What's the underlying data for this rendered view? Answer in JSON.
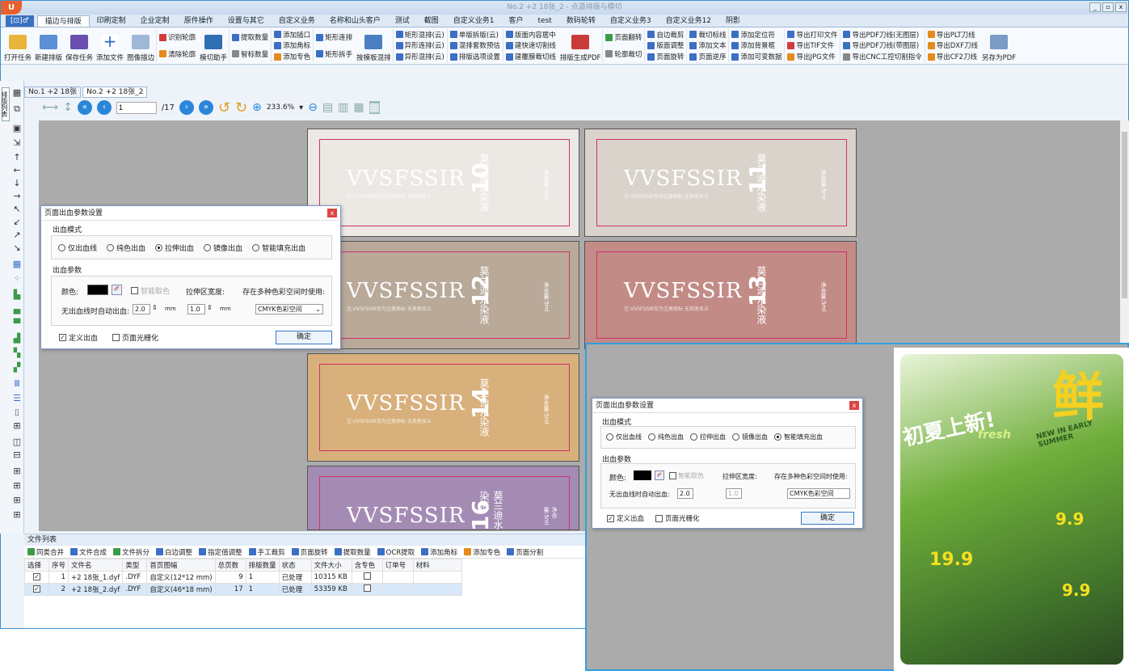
{
  "window": {
    "title": "No.2 +2 18张_2 - 点源排版与模切",
    "app_badge": "U"
  },
  "menu_tab": "[⊡]♂",
  "tabs": [
    "描边与排版",
    "印刷定制",
    "企业定制",
    "原件操作",
    "设置与其它",
    "自定义业务",
    "名称和山头客户",
    "测试",
    "截图",
    "自定义业务1",
    "客户",
    "test",
    "数码轮转",
    "自定义业务3",
    "自定义业务12",
    "阴影"
  ],
  "ribbon": {
    "big": [
      "打开任务",
      "新建排版",
      "保存任务",
      "添加文件",
      "图像描边"
    ],
    "col1": [
      "识别轮廓",
      "清除轮廓"
    ],
    "big2": "模切助手",
    "col2": [
      "提取数量",
      "智标数量"
    ],
    "col3": [
      "添加插口",
      "添加角标",
      "添加专色"
    ],
    "col4": [
      "矩形连排",
      "矩形拆手"
    ],
    "big3": "按模板混排",
    "col5": [
      "矩形混排(云)",
      "异形连排(云)",
      "异形混排(云)"
    ],
    "col6": [
      "单版拆版(云)",
      "混排套数预估",
      "排版选项设置"
    ],
    "col7": [
      "版面内容居中",
      "建快速切割线",
      "建覆膜裁切线"
    ],
    "big4": "排版生成PDF",
    "col8": [
      "页面翻转",
      "轮廓裁切"
    ],
    "col9": [
      "自边裁剪",
      "版面调整",
      "页面旋转"
    ],
    "col10": [
      "裁切标线",
      "添加文本",
      "页面逆序"
    ],
    "col11": [
      "添加定位符",
      "添加背景框",
      "添加可变数据"
    ],
    "col12": [
      "导出打印文件",
      "导出TIF文件",
      "导出JPG文件"
    ],
    "col13": [
      "导出PDF刀线(无图层)",
      "导出PDF刀线(带图层)",
      "导出CNC工控切割指令"
    ],
    "col14": [
      "导出PLT刀线",
      "导出DXF刀线",
      "导出CF2刀线"
    ],
    "big5": "另存为PDF"
  },
  "doc_tabs": [
    "No.1 +2 18张",
    "No.2 +2 18张_2"
  ],
  "nav": {
    "page": "1",
    "total": "/17",
    "zoom": "233.6%"
  },
  "side_tab": "排版列表",
  "cards": [
    {
      "num": "10",
      "bg": "#ece9e4",
      "brand": "VVSFSSIR",
      "cn": "莫兰迪水染液",
      "sub": "注:VVSFSSIR仅为注册商标 无其他含义",
      "vol": "净含量:5ml"
    },
    {
      "num": "11",
      "bg": "#d9d3cc",
      "brand": "VVSFSSIR",
      "cn": "莫兰迪水染液",
      "sub": "注:VVSFSSIR仅为注册商标 无其他含义",
      "vol": "净含量:5ml"
    },
    {
      "num": "12",
      "bg": "#b9a999",
      "brand": "VVSFSSIR",
      "cn": "莫兰迪水染液",
      "sub": "注:VVSFSSIR仅为注册商标 无其他含义",
      "vol": "净含量:5ml"
    },
    {
      "num": "13",
      "bg": "#c28b86",
      "brand": "VVSFSSIR",
      "cn": "莫兰迪水染液",
      "sub": "注:VVSFSSIR仅为注册商标 无其他含义",
      "vol": "净含量:5ml"
    },
    {
      "num": "14",
      "bg": "#d8b07c",
      "brand": "VVSFSSIR",
      "cn": "莫兰迪水染液",
      "sub": "注:VVSFSSIR仅为注册商标 无其他含义",
      "vol": "净含量:5ml"
    },
    {
      "num": "16",
      "bg": "#a48bb4",
      "brand": "VVSFSSIR",
      "cn": "莫兰迪水染液",
      "sub": "",
      "vol": "净含量:5ml"
    }
  ],
  "dialog1": {
    "title": "页面出血参数设置",
    "mode_label": "出血模式",
    "modes": [
      "仅出血线",
      "纯色出血",
      "拉伸出血",
      "镜像出血",
      "智能填充出血"
    ],
    "selected": 2,
    "param_label": "出血参数",
    "color_label": "颜色:",
    "smart_color": "智能取色",
    "stretch_label": "拉伸区宽度:",
    "colorspace_label": "存在多种色彩空间时使用:",
    "auto_label": "无出血线时自动出血:",
    "auto_val": "2.0",
    "stretch_val": "1.0",
    "unit": "mm",
    "colorspace": "CMYK色彩空间",
    "custom": "定义出血",
    "raster": "页面光栅化",
    "ok": "确定"
  },
  "dialog2": {
    "selected": 4
  },
  "filelist": {
    "title": "文件列表",
    "tools": [
      "同类合并",
      "文件合成",
      "文件拆分",
      "白边调整",
      "指定值调整",
      "手工裁剪",
      "页面旋转",
      "提取数量",
      "OCR提取",
      "添加角标",
      "添加专色",
      "页面分割"
    ],
    "headers": [
      "选择",
      "序号",
      "文件名",
      "类型",
      "首页图幅",
      "总页数",
      "排版数量",
      "状态",
      "文件大小",
      "含专色",
      "订单号",
      "材料"
    ],
    "rows": [
      {
        "idx": "1",
        "name": "+2 18张_1.dyf",
        "type": ".DYF",
        "size_name": "自定义(12*12 mm)",
        "pages": "9",
        "count": "1",
        "status": "已处理",
        "fsize": "10315 KB"
      },
      {
        "idx": "2",
        "name": "+2 18张_2.dyf",
        "type": ".DYF",
        "size_name": "自定义(46*18 mm)",
        "pages": "17",
        "count": "1",
        "status": "已处理",
        "fsize": "53359 KB"
      }
    ]
  },
  "poster": {
    "title": "初夏上新!",
    "big": "鲜",
    "fresh": "fresh",
    "en": "NEW IN EARLY SUMMER",
    "price1": "9.9",
    "price2": "19.9",
    "price3": "9.9"
  }
}
